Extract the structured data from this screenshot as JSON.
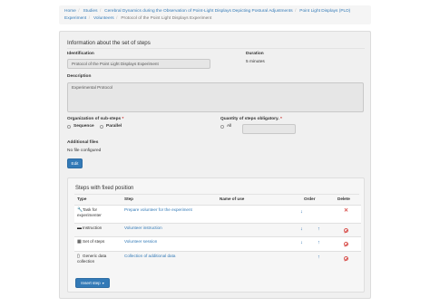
{
  "breadcrumb": {
    "items": [
      "Home",
      "Studies",
      "Cerebral Dynamics during the Observation of Point-Light Displays Depicting Postural Adjustments",
      "Point Light Displays (PLD) Experiment",
      "Volunteers",
      "Protocol of the Point Light Displays Experiment"
    ]
  },
  "info": {
    "title": "Information about the set of steps",
    "identification_label": "Identification",
    "identification_value": "Protocol of the Point Light Displays Experiment",
    "duration_label": "Duration",
    "duration_value": "5 minutes",
    "description_label": "Description",
    "description_value": "Experimental Protocol",
    "organization_label": "Organization of sub-steps",
    "organization_options": [
      "Sequence",
      "Parallel"
    ],
    "quantity_label": "Quantity of steps obligatory.",
    "quantity_option": "All",
    "additional_files_label": "Additional files",
    "additional_files_value": "No file configured",
    "edit_button": "Edit",
    "required_mark": "*"
  },
  "steps": {
    "title": "Steps with fixed position",
    "columns": {
      "type": "Type",
      "step": "Step",
      "name_of_use": "Name of use",
      "order": "Order",
      "delete": "Delete"
    },
    "rows": [
      {
        "type_icon": "wrench-icon",
        "type": "Task for experimenter",
        "step": "Prepare volunteer for the experiment",
        "down": true,
        "up": false,
        "delete": "x"
      },
      {
        "type_icon": "comment-icon",
        "type": "Instruction",
        "step": "Volunteer instruction",
        "down": true,
        "up": true,
        "delete": "ban"
      },
      {
        "type_icon": "th-icon",
        "type": "Set of steps",
        "step": "Volunteer session",
        "down": true,
        "up": true,
        "delete": "ban"
      },
      {
        "type_icon": "file-icon",
        "type": "Generic data collection",
        "step": "Collection of additional data",
        "down": false,
        "up": true,
        "delete": "ban"
      }
    ],
    "insert_button": "Insert step"
  },
  "colors": {
    "link": "#337ab7",
    "primary": "#337ab7",
    "danger": "#d9534f"
  }
}
